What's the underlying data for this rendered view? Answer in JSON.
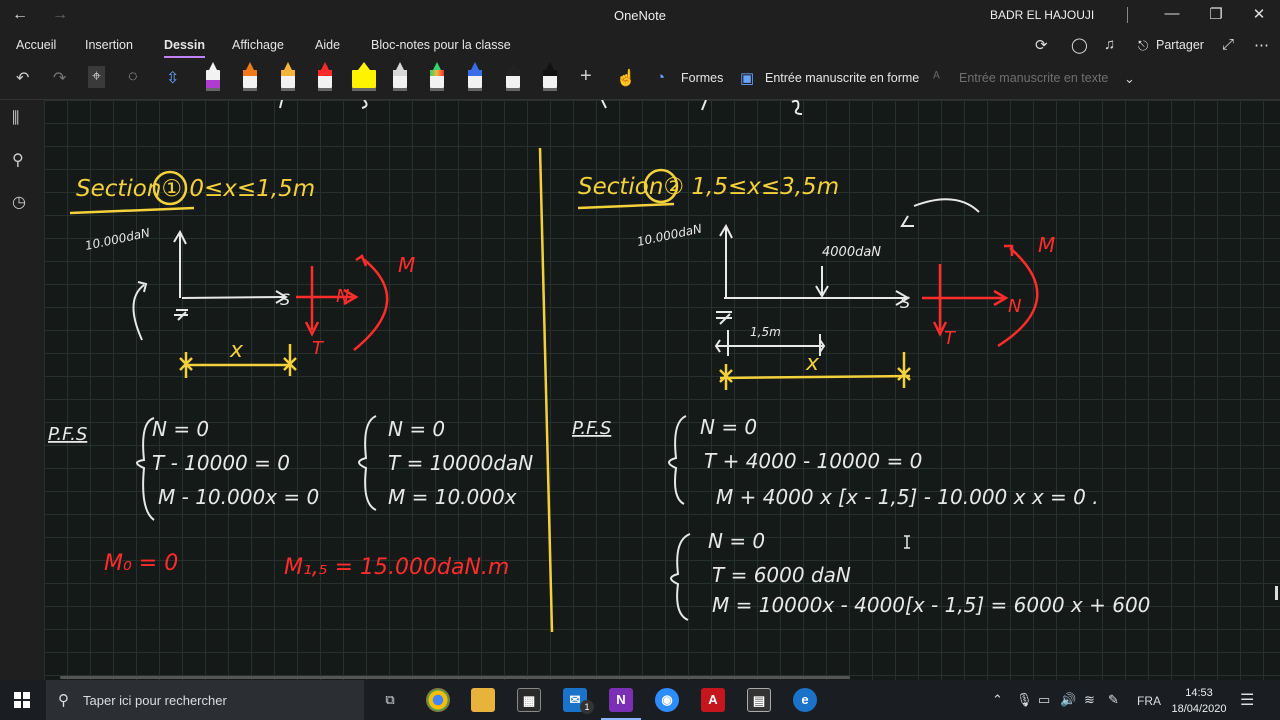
{
  "window": {
    "title": "OneNote",
    "user": "BADR EL HAJOUJI",
    "back_arrow": "←",
    "forward_arrow": "→",
    "minimize": "—",
    "maximize": "❐",
    "close": "✕"
  },
  "menu": {
    "items": [
      "Accueil",
      "Insertion",
      "Dessin",
      "Affichage",
      "Aide",
      "Bloc-notes pour la classe"
    ],
    "share": "Partager"
  },
  "toolbar": {
    "shapes": "Formes",
    "ink_to_shape": "Entrée manuscrite en forme",
    "ink_to_text": "Entrée manuscrite en texte",
    "pen_colors": [
      "#b03bd0",
      "#f07a1a",
      "#f0b53a",
      "#ff2a2a",
      "#fff400",
      "#d8d8d8",
      "#3ad06a",
      "#3a6ee8",
      "#222222",
      "#111111"
    ]
  },
  "ink_colors": {
    "yellow": "#f2d13c",
    "white": "#e8e8e8",
    "red": "#ff2c2c",
    "grid": "#27302b"
  },
  "notes": {
    "left": {
      "heading": "Section①  0≤x≤1,5m",
      "support_force": "10.000daN",
      "beam_x": "x",
      "labels": {
        "N": "N",
        "T": "T",
        "M": "M",
        "S": "S"
      },
      "pfs": "P.F.S",
      "sys1": [
        "N = 0",
        "T - 10000 = 0",
        "M - 10.000x = 0"
      ],
      "sys2": [
        "N = 0",
        "T = 10000daN",
        "M = 10.000x"
      ],
      "m0": "M₀ = 0",
      "m15": "M₁,₅ =  15.000daN.m"
    },
    "right": {
      "heading": "Section②  1,5≤x≤3,5m",
      "support_force": "10.000daN",
      "load": "4000daN",
      "len15": "1,5m",
      "beam_x": "x",
      "labels": {
        "N": "N",
        "T": "T",
        "M": "M",
        "S": "S"
      },
      "pfs": "P.F.S",
      "sys1": [
        "N = 0",
        "T + 4000 - 10000 = 0",
        "M + 4000 x [x - 1,5] - 10.000 x x = 0 ."
      ],
      "sys2": [
        "N = 0",
        "T = 6000 daN",
        "M = 10000x - 4000[x - 1,5] = 6000 x + 600"
      ]
    }
  },
  "taskbar": {
    "search_placeholder": "Taper ici pour rechercher",
    "language": "FRA",
    "time": "14:53",
    "date": "18/04/2020",
    "mail_badge": "1"
  }
}
